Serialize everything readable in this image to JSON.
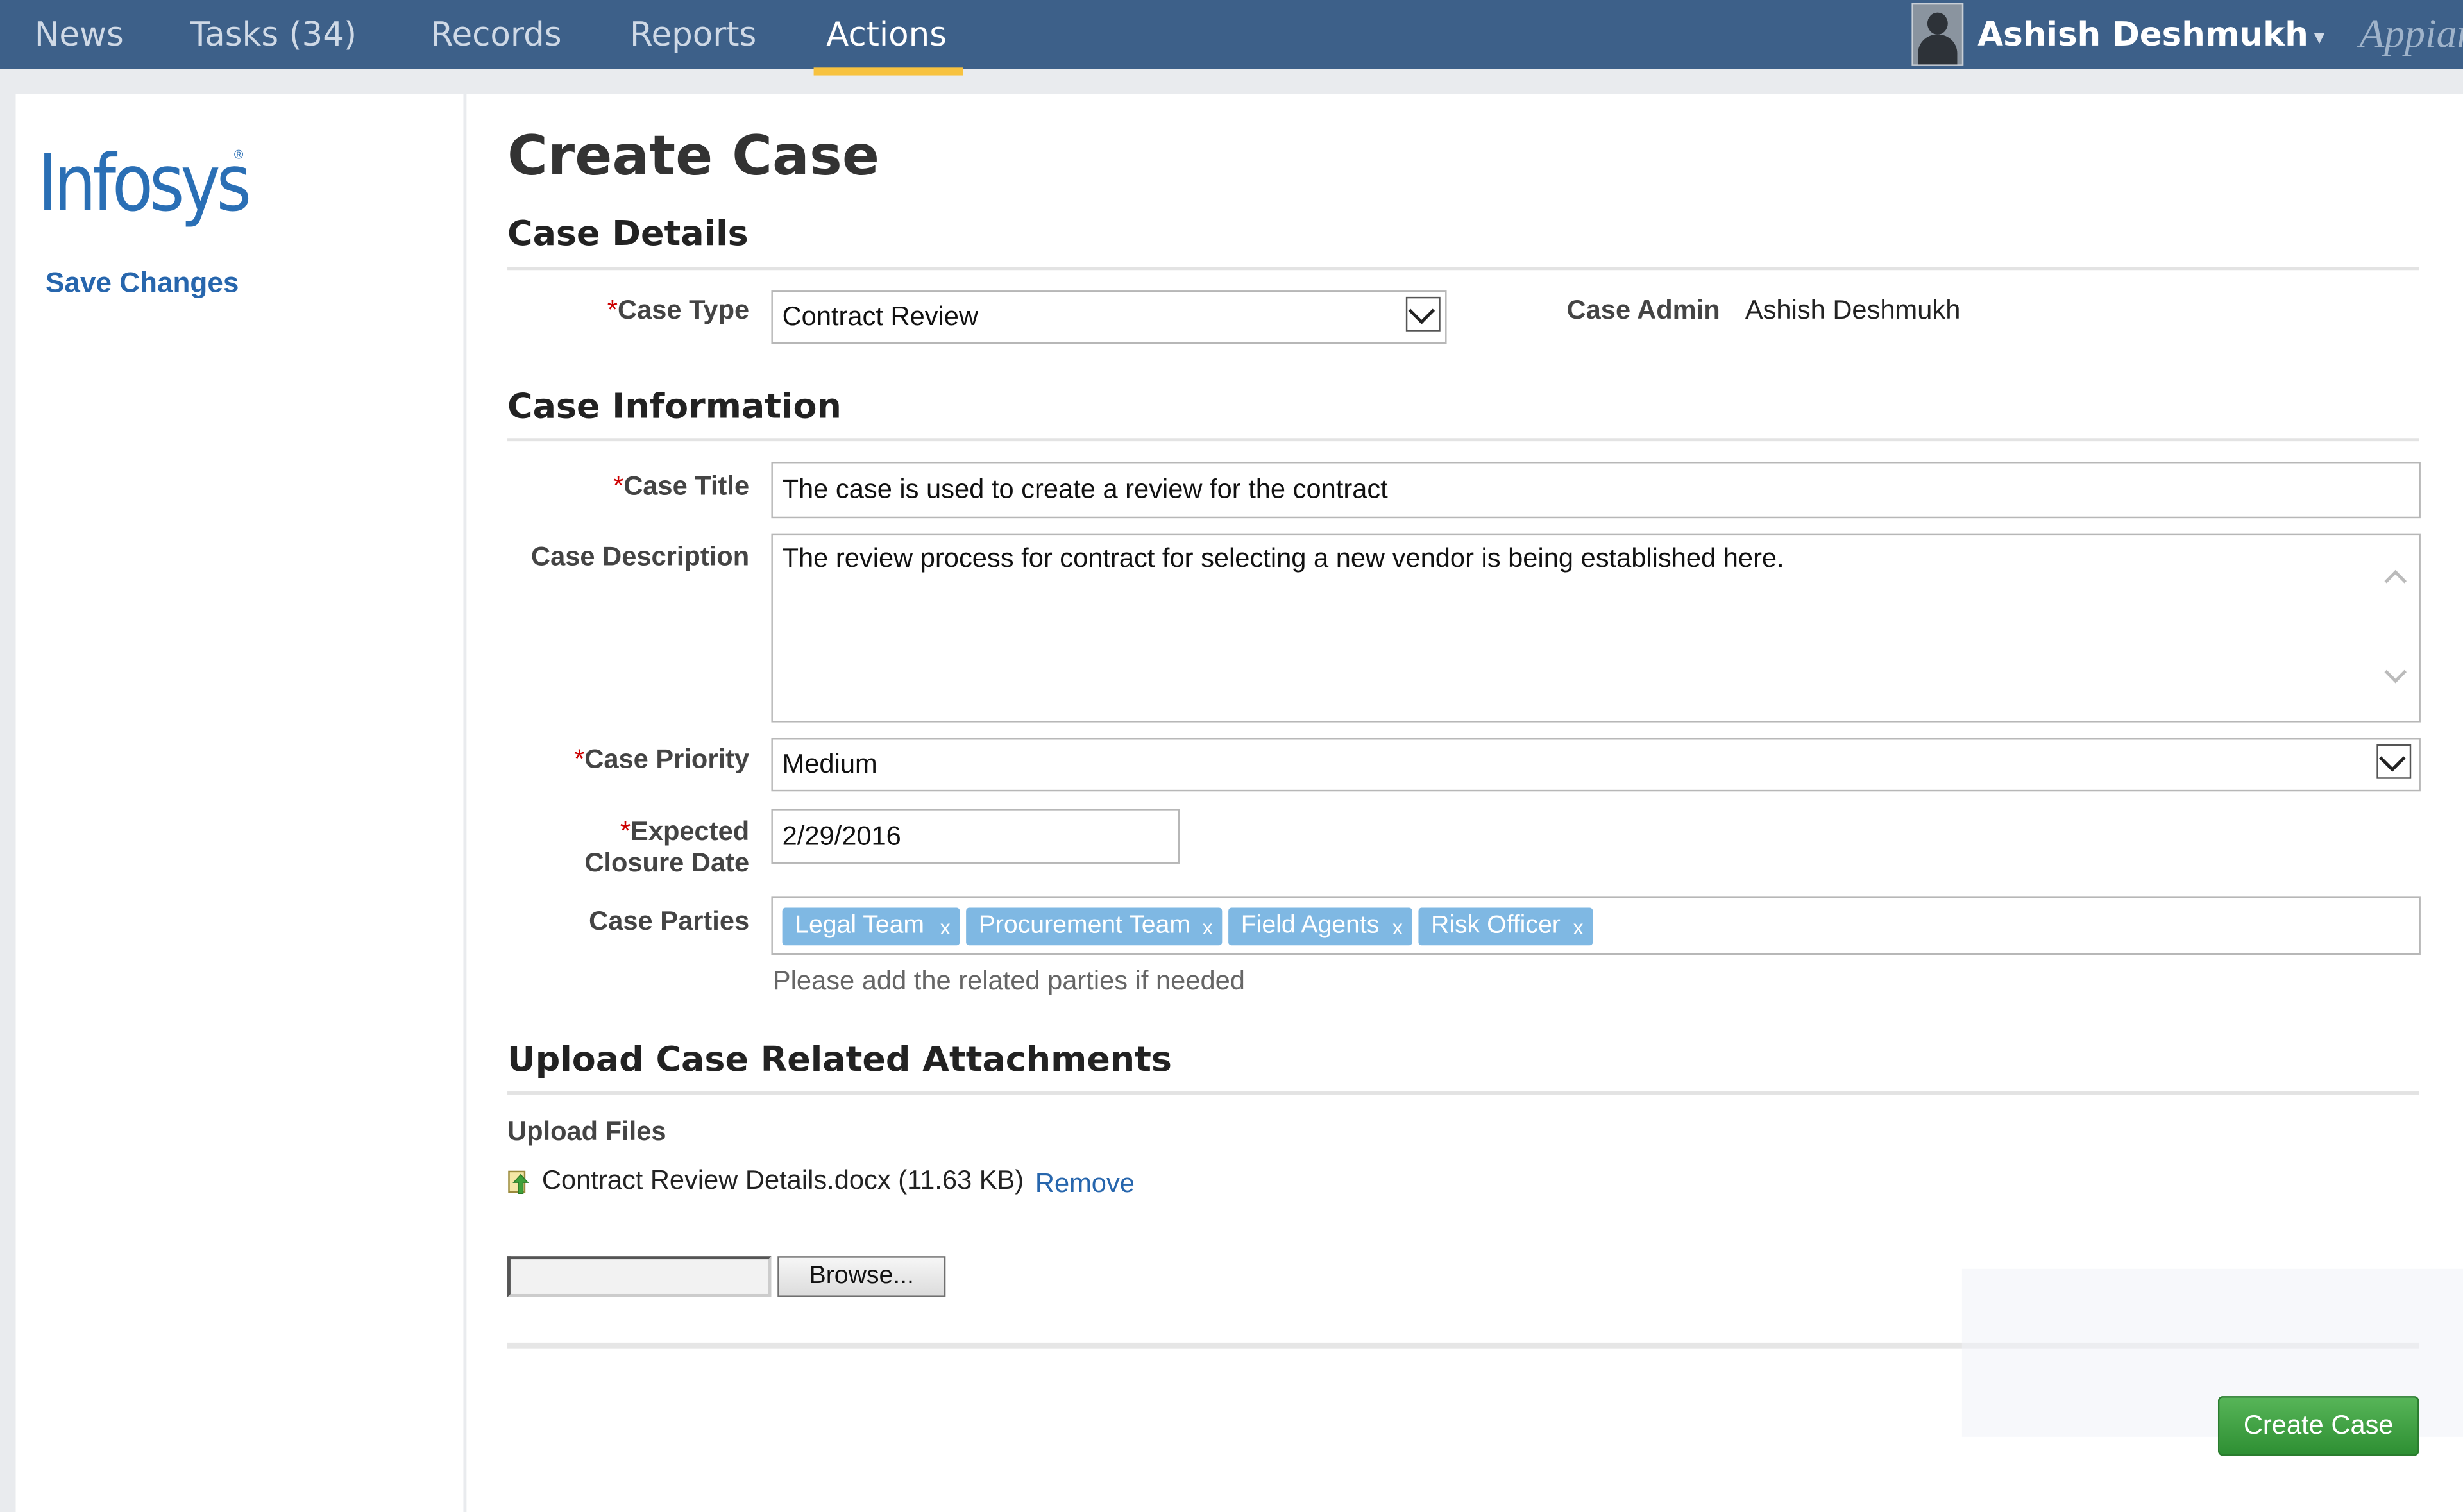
{
  "nav": {
    "tabs": [
      {
        "label": "News"
      },
      {
        "label": "Tasks (34)"
      },
      {
        "label": "Records"
      },
      {
        "label": "Reports"
      },
      {
        "label": "Actions"
      }
    ],
    "active_tab": "Actions",
    "user_name": "Ashish Deshmukh",
    "user_caret": "▾",
    "brand": "Appian"
  },
  "sidebar": {
    "logo_text": "Infosys",
    "logo_reg": "®",
    "save_changes_label": "Save Changes"
  },
  "page": {
    "title": "Create Case",
    "sections": {
      "details": "Case Details",
      "information": "Case Information",
      "attachments": "Upload Case Related Attachments"
    },
    "required_marker": "*",
    "case_type": {
      "label": "Case Type",
      "value": "Contract Review"
    },
    "case_admin": {
      "label": "Case Admin",
      "value": "Ashish Deshmukh"
    },
    "case_title": {
      "label": "Case Title",
      "value": "The case is used to create a review for the contract"
    },
    "case_description": {
      "label": "Case Description",
      "value": "The review process for contract for selecting a new vendor is being established here."
    },
    "case_priority": {
      "label": "Case Priority",
      "value": "Medium"
    },
    "expected_closure": {
      "label_line1": "Expected",
      "label_line2": "Closure Date",
      "value": "2/29/2016"
    },
    "case_parties": {
      "label": "Case Parties",
      "tokens": [
        "Legal Team",
        "Procurement Team",
        "Field Agents",
        "Risk Officer"
      ],
      "remove_glyph": "x",
      "hint": "Please add the related parties if needed"
    },
    "upload": {
      "label": "Upload Files",
      "file_name": "Contract Review Details.docx (11.63 KB)",
      "remove_label": "Remove",
      "browse_label": "Browse..."
    },
    "create_button_label": "Create Case"
  },
  "colors": {
    "nav_bg": "#3d6089",
    "nav_active_underline": "#f7c23f",
    "link_blue": "#2766ad",
    "token_bg": "#7fb8e3",
    "create_green": "#3a9a3e",
    "required_red": "#cc0000"
  },
  "icons": [
    "user-avatar-icon",
    "select-chevron-icon",
    "scroll-up-icon",
    "scroll-down-icon",
    "file-upload-icon"
  ]
}
